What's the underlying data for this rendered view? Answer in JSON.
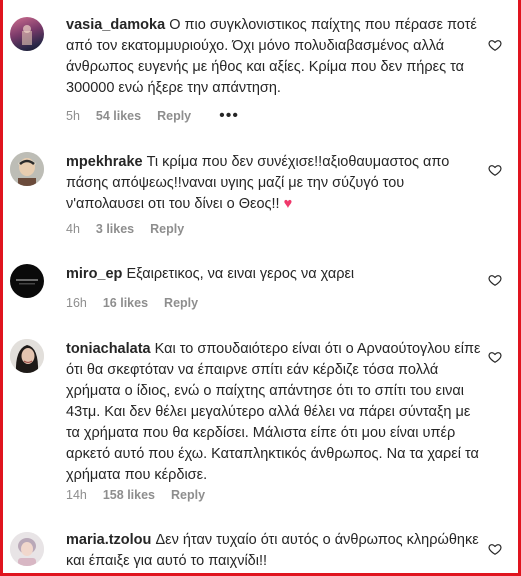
{
  "comments": [
    {
      "username": "vasia_damoka",
      "text": "Ο πιο συγκλονιστικος παίχτης που πέρασε ποτέ από τον εκατομμυριούχο. Όχι μόνο πολυδιαβασμένος αλλά άνθρωπος ευγενής με ήθος και αξίες. Κρίμα που δεν πήρες τα 300000 ενώ ήξερε την απάντηση.",
      "time": "5h",
      "likes": "54 likes",
      "reply": "Reply",
      "more": "•••"
    },
    {
      "username": "mpekhrake",
      "text": "Τι κρίμα που δεν συνέχισε!!αξιοθαυμαστος απο πάσης απόψεως!!ναναι υγιης μαζί με την σύζυγό του ν'απολαυσει οτι του δίνει ο Θεος!!",
      "emoji": "♥",
      "time": "4h",
      "likes": "3 likes",
      "reply": "Reply"
    },
    {
      "username": "miro_ep",
      "text": "Εξαιρετικος, να ειναι γερος να χαρει",
      "time": "16h",
      "likes": "16 likes",
      "reply": "Reply"
    },
    {
      "username": "toniachalata",
      "text": "Και το σπουδαιότερο είναι ότι ο Αρναούτογλου είπε ότι θα σκεφτόταν να έπαιρνε σπίτι εάν κέρδιζε τόσα πολλά χρήματα ο ίδιος, ενώ ο παίχτης απάντησε ότι το σπίτι του ειναι 43τμ. Και δεν θέλει μεγαλύτερο αλλά θέλει να πάρει σύνταξη με τα χρήματα που θα κερδίσει. Μάλιστα είπε ότι μου είναι υπέρ αρκετό αυτό που έχω. Καταπληκτικός άνθρωπος. Να τα χαρεί τα χρήματα που κέρδισε.",
      "time": "14h",
      "likes": "158 likes",
      "reply": "Reply"
    },
    {
      "username": "maria.tzolou",
      "text": "Δεν ήταν τυχαίο ότι αυτός ο άνθρωπος κληρώθηκε και έπαιξε για αυτό το παιχνίδι!!",
      "time": "",
      "likes": "",
      "reply": ""
    }
  ],
  "colors": {
    "border": "#e0141e",
    "meta": "#8e8e8e",
    "text": "#262626",
    "heart_emoji": "#f0386b"
  }
}
